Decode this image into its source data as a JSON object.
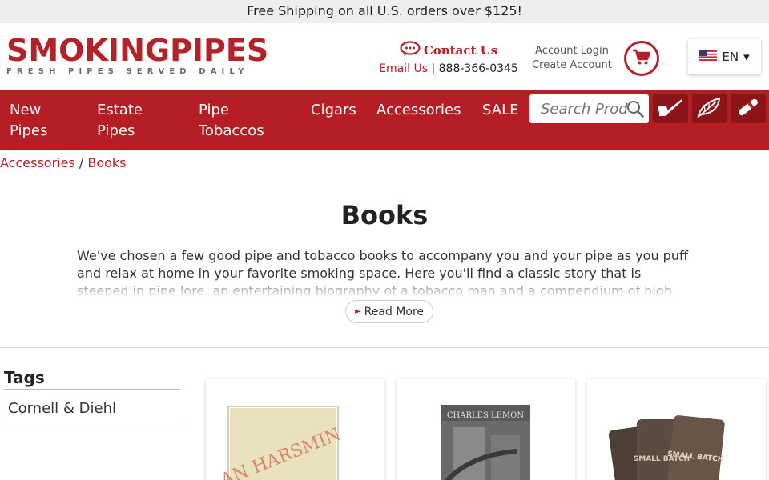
{
  "promo": {
    "text": "Free Shipping on all U.S. orders over $125!"
  },
  "logo": {
    "name": "SMOKINGPIPES",
    "tagline": "FRESH PIPES SERVED DAILY"
  },
  "contact": {
    "title": "Contact Us",
    "email_label": "Email Us",
    "separator": "|",
    "phone": "888-366-0345"
  },
  "account": {
    "login": "Account Login",
    "create": "Create Account"
  },
  "cart": {
    "icon": "cart-icon"
  },
  "language": {
    "code": "EN",
    "caret": "▾",
    "flag": "us-flag-icon"
  },
  "nav": {
    "items": [
      {
        "line1": "New",
        "line2": "Pipes"
      },
      {
        "line1": "Estate",
        "line2": "Pipes"
      },
      {
        "line1": "Pipe",
        "line2": "Tobaccos"
      },
      {
        "line1": "Cigars",
        "line2": ""
      },
      {
        "line1": "Accessories",
        "line2": ""
      },
      {
        "line1": "SALE",
        "line2": ""
      }
    ],
    "search_placeholder": "Search Products",
    "tool_buttons": [
      "pipe-icon",
      "tobacco-leaf-icon",
      "cigar-icon"
    ]
  },
  "breadcrumb": {
    "parent": "Accessories",
    "separator": "/",
    "current": "Books"
  },
  "page": {
    "title": "Books",
    "description": "We've chosen a few good pipe and tobacco books to accompany you and your pipe as you puff and relax at home in your favorite smoking space. Here you'll find a classic story that is steeped in pipe lore, an entertaining biography of a tobacco man and a compendium of high",
    "read_more": "Read More"
  },
  "sidebar": {
    "tags_title": "Tags",
    "tags": [
      "Cornell & Diehl"
    ]
  },
  "products": [
    {
      "cover_text": "AN HARSMIN"
    },
    {
      "cover_text": "CHARLES LEMON"
    },
    {
      "cover_text": "SMALL BATCH"
    }
  ],
  "colors": {
    "brand": "#b2222a",
    "nav_bg": "#b41e24",
    "button_dark": "#8c1318"
  }
}
